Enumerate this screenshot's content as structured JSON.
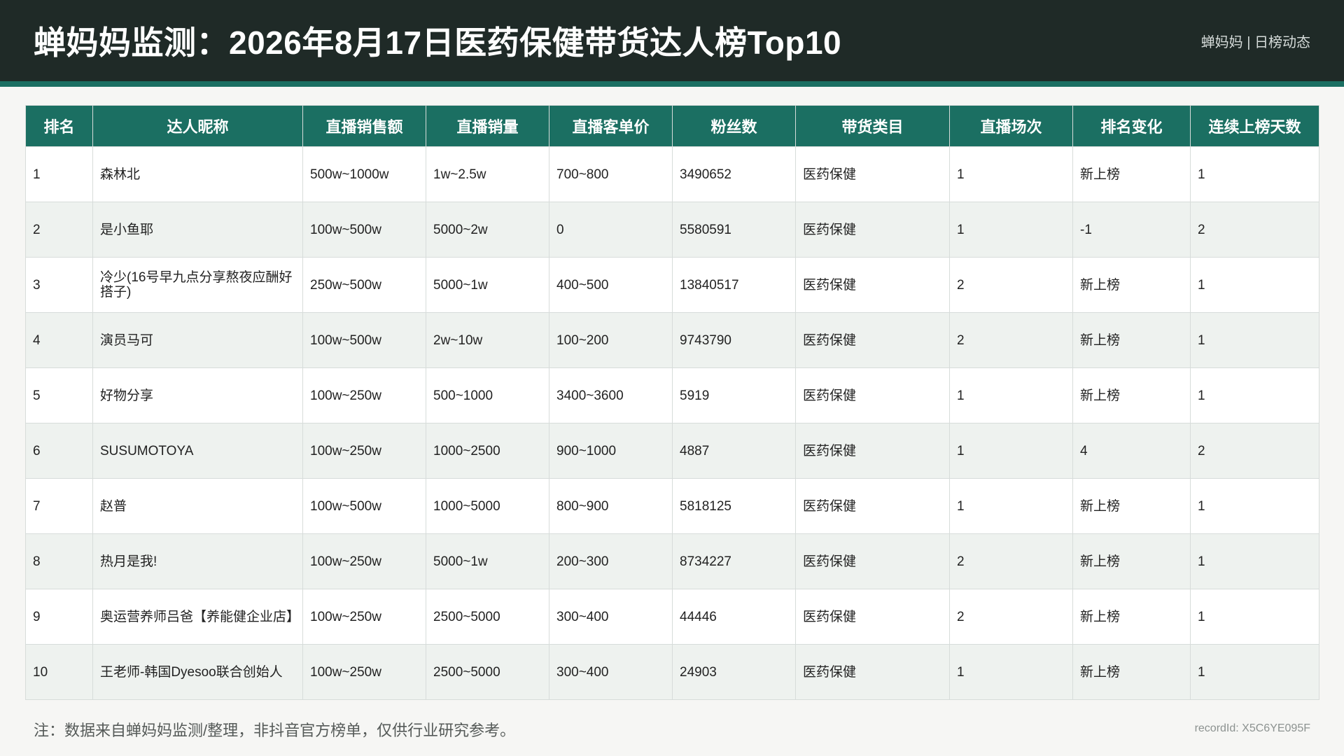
{
  "header": {
    "title": "蝉妈妈监测：2026年8月17日医药保健带货达人榜Top10",
    "brand": "蝉妈妈 | 日榜动态"
  },
  "table": {
    "columns": [
      "排名",
      "达人昵称",
      "直播销售额",
      "直播销量",
      "直播客单价",
      "粉丝数",
      "带货类目",
      "直播场次",
      "排名变化",
      "连续上榜天数"
    ],
    "rows": [
      [
        "1",
        "森林北",
        "500w~1000w",
        "1w~2.5w",
        "700~800",
        "3490652",
        "医药保健",
        "1",
        "新上榜",
        "1"
      ],
      [
        "2",
        "是小鱼耶",
        "100w~500w",
        "5000~2w",
        "0",
        "5580591",
        "医药保健",
        "1",
        "-1",
        "2"
      ],
      [
        "3",
        "冷少(16号早九点分享熬夜应酬好搭子)",
        "250w~500w",
        "5000~1w",
        "400~500",
        "13840517",
        "医药保健",
        "2",
        "新上榜",
        "1"
      ],
      [
        "4",
        "演员马可",
        "100w~500w",
        "2w~10w",
        "100~200",
        "9743790",
        "医药保健",
        "2",
        "新上榜",
        "1"
      ],
      [
        "5",
        "好物分享",
        "100w~250w",
        "500~1000",
        "3400~3600",
        "5919",
        "医药保健",
        "1",
        "新上榜",
        "1"
      ],
      [
        "6",
        "SUSUMOTOYA",
        "100w~250w",
        "1000~2500",
        "900~1000",
        "4887",
        "医药保健",
        "1",
        "4",
        "2"
      ],
      [
        "7",
        "赵普",
        "100w~500w",
        "1000~5000",
        "800~900",
        "5818125",
        "医药保健",
        "1",
        "新上榜",
        "1"
      ],
      [
        "8",
        "热月是我!",
        "100w~250w",
        "5000~1w",
        "200~300",
        "8734227",
        "医药保健",
        "2",
        "新上榜",
        "1"
      ],
      [
        "9",
        "奥运营养师吕爸【养能健企业店】",
        "100w~250w",
        "2500~5000",
        "300~400",
        "44446",
        "医药保健",
        "2",
        "新上榜",
        "1"
      ],
      [
        "10",
        "王老师-韩国Dyesoo联合创始人",
        "100w~250w",
        "2500~5000",
        "300~400",
        "24903",
        "医药保健",
        "1",
        "新上榜",
        "1"
      ]
    ]
  },
  "footer": {
    "note": "注：数据来自蝉妈妈监测/整理，非抖音官方榜单，仅供行业研究参考。",
    "record_id": "recordId: X5C6YE095F"
  },
  "colors": {
    "header_bg": "#1f2a27",
    "accent": "#1b6f62",
    "row_alt": "#eef2ef"
  }
}
